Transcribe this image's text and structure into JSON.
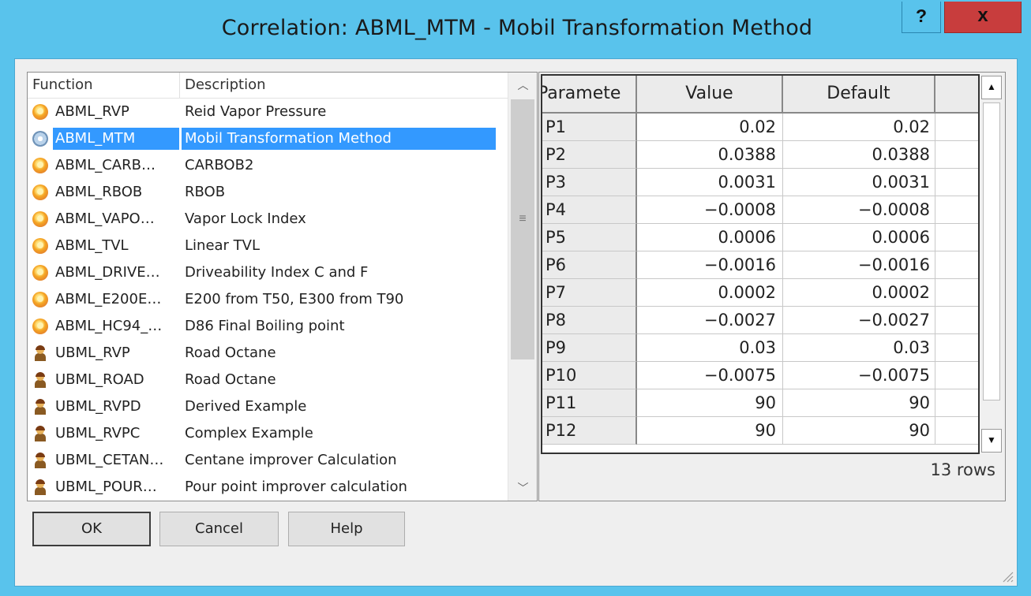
{
  "window": {
    "title": "Correlation: ABML_MTM - Mobil Transformation Method",
    "help_label": "?",
    "close_label": "x"
  },
  "list": {
    "headers": {
      "function": "Function",
      "description": "Description"
    },
    "items": [
      {
        "function": "ABML_RVP",
        "description": "Reid Vapor Pressure",
        "icon": "orange-ball-icon"
      },
      {
        "function": "ABML_MTM",
        "description": "Mobil Transformation Method",
        "icon": "gear-ball-icon",
        "selected": true
      },
      {
        "function": "ABML_CARB…",
        "description": "CARBOB2",
        "icon": "orange-ball-icon"
      },
      {
        "function": "ABML_RBOB",
        "description": "RBOB",
        "icon": "orange-ball-icon"
      },
      {
        "function": "ABML_VAPO…",
        "description": "Vapor Lock Index",
        "icon": "orange-ball-icon"
      },
      {
        "function": "ABML_TVL",
        "description": "Linear TVL",
        "icon": "orange-ball-icon"
      },
      {
        "function": "ABML_DRIVE…",
        "description": "Driveability Index C and F",
        "icon": "orange-ball-icon"
      },
      {
        "function": "ABML_E200E…",
        "description": "E200 from T50, E300 from T90",
        "icon": "orange-ball-icon"
      },
      {
        "function": "ABML_HC94_…",
        "description": "D86 Final Boiling point",
        "icon": "orange-ball-icon"
      },
      {
        "function": "UBML_RVP",
        "description": "Road Octane",
        "icon": "user-icon"
      },
      {
        "function": "UBML_ROAD",
        "description": "Road Octane",
        "icon": "user-icon"
      },
      {
        "function": "UBML_RVPD",
        "description": "Derived Example",
        "icon": "user-icon"
      },
      {
        "function": "UBML_RVPC",
        "description": "Complex Example",
        "icon": "user-icon"
      },
      {
        "function": "UBML_CETAN…",
        "description": "Centane improver Calculation",
        "icon": "user-icon"
      },
      {
        "function": "UBML_POUR…",
        "description": "Pour point improver calculation",
        "icon": "user-icon"
      }
    ]
  },
  "buttons": {
    "ok": "OK",
    "cancel": "Cancel",
    "help": "Help"
  },
  "grid": {
    "headers": {
      "parameter": "Paramete",
      "value": "Value",
      "default": "Default"
    },
    "rows": [
      {
        "p": "P1",
        "value": "0.02",
        "default": "0.02"
      },
      {
        "p": "P2",
        "value": "0.0388",
        "default": "0.0388"
      },
      {
        "p": "P3",
        "value": "0.0031",
        "default": "0.0031"
      },
      {
        "p": "P4",
        "value": "−0.0008",
        "default": "−0.0008"
      },
      {
        "p": "P5",
        "value": "0.0006",
        "default": "0.0006"
      },
      {
        "p": "P6",
        "value": "−0.0016",
        "default": "−0.0016"
      },
      {
        "p": "P7",
        "value": "0.0002",
        "default": "0.0002"
      },
      {
        "p": "P8",
        "value": "−0.0027",
        "default": "−0.0027"
      },
      {
        "p": "P9",
        "value": "0.03",
        "default": "0.03"
      },
      {
        "p": "P10",
        "value": "−0.0075",
        "default": "−0.0075"
      },
      {
        "p": "P11",
        "value": "90",
        "default": "90"
      },
      {
        "p": "P12",
        "value": "90",
        "default": "90"
      }
    ],
    "row_count": "13 rows"
  },
  "colors": {
    "titlebar": "#59c3ec",
    "close": "#c83d3d",
    "selection": "#3399ff"
  }
}
